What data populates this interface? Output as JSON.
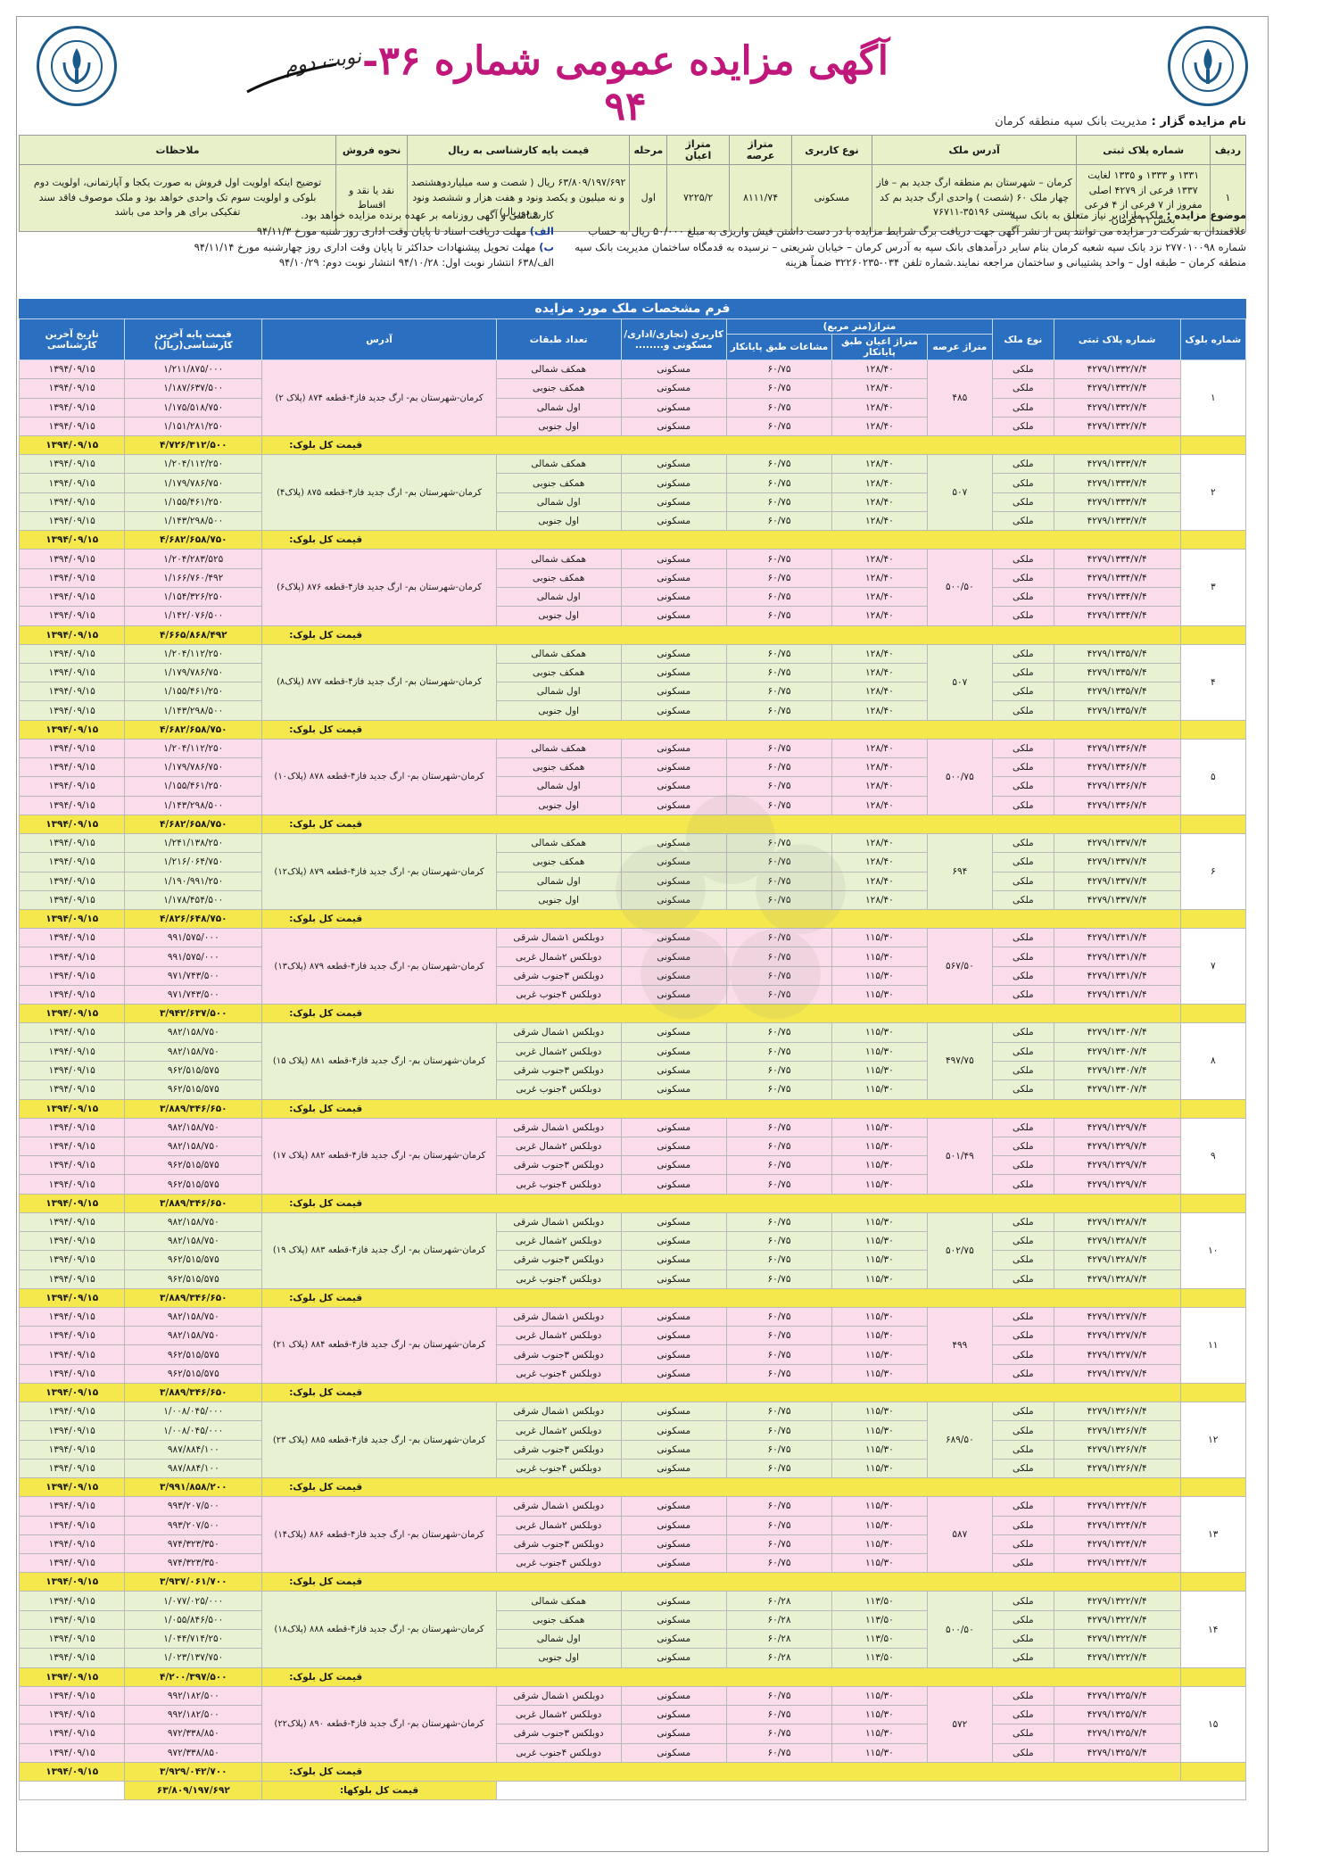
{
  "header": {
    "title": "آگهی مزایده عمومی شماره  ۳۶- ۹۴",
    "nobat": "نوبت دوم",
    "auctioneer_label": "نام مزایده گزار : ",
    "auctioneer_value": "مدیریت بانک سپه منطقه کرمان"
  },
  "summary": {
    "headers": [
      "ردیف",
      "شماره پلاک ثبتی",
      "آدرس ملک",
      "نوع کاربری",
      "متراژ عرصه",
      "متراژ اعیان",
      "مرحله",
      "قیمت پایه کارشناسی به ریال",
      "نحوه فروش",
      "ملاحظات"
    ],
    "row": [
      "۱",
      "۱۳۳۱ و ۱۳۳۳ و ۱۳۳۵ لغایت ۱۳۳۷ فرعی از ۴۲۷۹ اصلی مفروز از ۷ فرعی از ۴ فرعی بخش ۳۱ کرمان",
      "کرمان – شهرستان بم منطقه ارگ جدید بم – فاز چهار ملک ۶۰ (شصت ) واحدی ارگ جدید بم کد پستی ۳۵۱۹۶-۷۶۷۱۱",
      "مسکونی",
      "۸۱۱۱/۷۴",
      "۷۲۲۵/۲",
      "اول",
      "۶۳/۸۰۹/۱۹۷/۶۹۲ ریال ( شصت و سه میلیاردوهشتصد و نه میلیون و یکصد ونود و هفت هزار و ششصد ونود و دوریال)",
      "نقد یا نقد و اقساط",
      "توضیح اینکه اولویت اول فروش به صورت یکجا و آپارتمانی، اولویت دوم بلوکی و اولویت سوم تک واحدی خواهد بود و ملک موصوف فاقد سند تفکیکی برای هر واحد می باشد"
    ]
  },
  "notes": {
    "subject_label": "موضوع مزایده :",
    "subject_text": " ملک مازاد بر نیاز متعلق به بانک سپه",
    "para": "علاقمندان به شرکت در مزایده می توانند پس از نشر آگهی جهت دریافت برگ شرایط مزایده با در دست داشتن فیش واریزی به مبلغ ۵۰/۰۰۰ ریال به حساب شماره ۲۷۷۰۱۰۰۹۸ نزد بانک سپه شعبه کرمان بنام سایر درآمدهای بانک سپه به آدرس کرمان – خیابان شریعتی – نرسیده به قدمگاه ساختمان مدیریت بانک سپه منطقه کرمان – طبقه اول – واحد پشتیبانی و ساختمان مراجعه نمایند.شماره تلفن ۰۳۴-۳۲۲۶۰۲۳۵ ضمناً هزینه",
    "r1": "کارشناسی و آگهی روزنامه بر عهده برنده مزایده خواهد بود.",
    "r2_label": "الف)",
    "r2": " مهلت دریافت اسناد تا پایان وقت اداری روز شنبه مورخ ۹۴/۱۱/۳",
    "r3_label": "ب)",
    "r3": " مهلت تحویل پیشنهادات حداکثر تا پایان وقت اداری روز چهارشنبه مورخ ۹۴/۱۱/۱۴",
    "r4": "الف/۶۳۸    انتشار نوبت اول: ۹۴/۱۰/۲۸         انتشار نوبت دوم: ۹۴/۱۰/۲۹"
  },
  "form_title": "فرم مشخصات ملک مورد مزایده",
  "table_headers": {
    "block_no": "شماره بلوک",
    "plate": "شماره پلاک ثبتی",
    "ownership": "نوع ملک",
    "metraj_group": "متراژ(متر مربع)",
    "arse": "متراژ عرصه",
    "ayan": "متراژ اعیان طبق پایانکار",
    "mosha": "مشاعات طبق پایانکار",
    "usage": "کاربری (تجاری/اداری/ مسکونی و........",
    "floors": "تعداد طبقات",
    "address": "آدرس",
    "price": "قیمت پایه آخرین کارشناسی(ریال)",
    "date": "تاریخ آخرین کارشناسی"
  },
  "total_label": "قیمت کل بلوک:",
  "grand_label": "قیمت کل بلوکها:",
  "grand_value": "۶۳/۸۰۹/۱۹۷/۶۹۲",
  "usage_value": "مسکونی",
  "owner_value": "ملکی",
  "date_value": "۱۳۹۴/۰۹/۱۵",
  "blocks": [
    {
      "no": "۱",
      "arse": "۴۸۵",
      "addr": "کرمان-شهرستان بم- ارگ جدید فاز۴-قطعه ۸۷۴ (پلاک ۲)",
      "total": "۴/۷۲۶/۳۱۲/۵۰۰",
      "rows": [
        {
          "plate": "۴۲۷۹/۱۳۳۲/۷/۴",
          "ayan": "۱۲۸/۴۰",
          "mosha": "۶۰/۷۵",
          "floor": "همکف شمالی",
          "price": "۱/۲۱۱/۸۷۵/۰۰۰"
        },
        {
          "plate": "۴۲۷۹/۱۳۳۲/۷/۴",
          "ayan": "۱۲۸/۴۰",
          "mosha": "۶۰/۷۵",
          "floor": "همکف جنوبی",
          "price": "۱/۱۸۷/۶۳۷/۵۰۰"
        },
        {
          "plate": "۴۲۷۹/۱۳۳۲/۷/۴",
          "ayan": "۱۲۸/۴۰",
          "mosha": "۶۰/۷۵",
          "floor": "اول شمالی",
          "price": "۱/۱۷۵/۵۱۸/۷۵۰"
        },
        {
          "plate": "۴۲۷۹/۱۳۳۲/۷/۴",
          "ayan": "۱۲۸/۴۰",
          "mosha": "۶۰/۷۵",
          "floor": "اول جنوبی",
          "price": "۱/۱۵۱/۲۸۱/۲۵۰"
        }
      ]
    },
    {
      "no": "۲",
      "arse": "۵۰۷",
      "addr": "کرمان-شهرستان بم- ارگ جدید فاز۴-قطعه ۸۷۵ (پلاک۴)",
      "total": "۴/۶۸۲/۶۵۸/۷۵۰",
      "rows": [
        {
          "plate": "۴۲۷۹/۱۳۳۳/۷/۴",
          "ayan": "۱۲۸/۴۰",
          "mosha": "۶۰/۷۵",
          "floor": "همکف شمالی",
          "price": "۱/۲۰۴/۱۱۲/۲۵۰"
        },
        {
          "plate": "۴۲۷۹/۱۳۳۳/۷/۴",
          "ayan": "۱۲۸/۴۰",
          "mosha": "۶۰/۷۵",
          "floor": "همکف جنوبی",
          "price": "۱/۱۷۹/۷۸۶/۷۵۰"
        },
        {
          "plate": "۴۲۷۹/۱۳۳۳/۷/۴",
          "ayan": "۱۲۸/۴۰",
          "mosha": "۶۰/۷۵",
          "floor": "اول شمالی",
          "price": "۱/۱۵۵/۴۶۱/۲۵۰"
        },
        {
          "plate": "۴۲۷۹/۱۳۳۳/۷/۴",
          "ayan": "۱۲۸/۴۰",
          "mosha": "۶۰/۷۵",
          "floor": "اول جنوبی",
          "price": "۱/۱۴۳/۲۹۸/۵۰۰"
        }
      ]
    },
    {
      "no": "۳",
      "arse": "۵۰۰/۵۰",
      "addr": "کرمان-شهرستان بم- ارگ جدید فاز۴-قطعه ۸۷۶ (پلاک۶)",
      "total": "۴/۶۶۵/۸۶۸/۴۹۲",
      "rows": [
        {
          "plate": "۴۲۷۹/۱۳۳۴/۷/۴",
          "ayan": "۱۲۸/۴۰",
          "mosha": "۶۰/۷۵",
          "floor": "همکف شمالی",
          "price": "۱/۲۰۴/۲۸۳/۵۲۵"
        },
        {
          "plate": "۴۲۷۹/۱۳۳۴/۷/۴",
          "ayan": "۱۲۸/۴۰",
          "mosha": "۶۰/۷۵",
          "floor": "همکف جنوبی",
          "price": "۱/۱۶۶/۷۶۰/۴۹۲"
        },
        {
          "plate": "۴۲۷۹/۱۳۳۴/۷/۴",
          "ayan": "۱۲۸/۴۰",
          "mosha": "۶۰/۷۵",
          "floor": "اول شمالی",
          "price": "۱/۱۵۴/۳۲۶/۲۵۰"
        },
        {
          "plate": "۴۲۷۹/۱۳۳۴/۷/۴",
          "ayan": "۱۲۸/۴۰",
          "mosha": "۶۰/۷۵",
          "floor": "اول جنوبی",
          "price": "۱/۱۴۲/۰۷۶/۵۰۰"
        }
      ]
    },
    {
      "no": "۴",
      "arse": "۵۰۷",
      "addr": "کرمان-شهرستان بم- ارگ جدید فاز۴-قطعه ۸۷۷ (پلاک۸)",
      "total": "۴/۶۸۲/۶۵۸/۷۵۰",
      "rows": [
        {
          "plate": "۴۲۷۹/۱۳۳۵/۷/۴",
          "ayan": "۱۲۸/۴۰",
          "mosha": "۶۰/۷۵",
          "floor": "همکف شمالی",
          "price": "۱/۲۰۴/۱۱۲/۲۵۰"
        },
        {
          "plate": "۴۲۷۹/۱۳۳۵/۷/۴",
          "ayan": "۱۲۸/۴۰",
          "mosha": "۶۰/۷۵",
          "floor": "همکف جنوبی",
          "price": "۱/۱۷۹/۷۸۶/۷۵۰"
        },
        {
          "plate": "۴۲۷۹/۱۳۳۵/۷/۴",
          "ayan": "۱۲۸/۴۰",
          "mosha": "۶۰/۷۵",
          "floor": "اول شمالی",
          "price": "۱/۱۵۵/۴۶۱/۲۵۰"
        },
        {
          "plate": "۴۲۷۹/۱۳۳۵/۷/۴",
          "ayan": "۱۲۸/۴۰",
          "mosha": "۶۰/۷۵",
          "floor": "اول جنوبی",
          "price": "۱/۱۴۳/۲۹۸/۵۰۰"
        }
      ]
    },
    {
      "no": "۵",
      "arse": "۵۰۰/۷۵",
      "addr": "کرمان-شهرستان بم- ارگ جدید فاز۴-قطعه ۸۷۸ (پلاک۱۰)",
      "total": "۴/۶۸۲/۶۵۸/۷۵۰",
      "rows": [
        {
          "plate": "۴۲۷۹/۱۳۳۶/۷/۴",
          "ayan": "۱۲۸/۴۰",
          "mosha": "۶۰/۷۵",
          "floor": "همکف شمالی",
          "price": "۱/۲۰۴/۱۱۲/۲۵۰"
        },
        {
          "plate": "۴۲۷۹/۱۳۳۶/۷/۴",
          "ayan": "۱۲۸/۴۰",
          "mosha": "۶۰/۷۵",
          "floor": "همکف جنوبی",
          "price": "۱/۱۷۹/۷۸۶/۷۵۰"
        },
        {
          "plate": "۴۲۷۹/۱۳۳۶/۷/۴",
          "ayan": "۱۲۸/۴۰",
          "mosha": "۶۰/۷۵",
          "floor": "اول شمالی",
          "price": "۱/۱۵۵/۴۶۱/۲۵۰"
        },
        {
          "plate": "۴۲۷۹/۱۳۳۶/۷/۴",
          "ayan": "۱۲۸/۴۰",
          "mosha": "۶۰/۷۵",
          "floor": "اول جنوبی",
          "price": "۱/۱۴۳/۲۹۸/۵۰۰"
        }
      ]
    },
    {
      "no": "۶",
      "arse": "۶۹۴",
      "addr": "کرمان-شهرستان بم- ارگ جدید فاز۴-قطعه ۸۷۹ (پلاک۱۲)",
      "total": "۴/۸۲۶/۶۴۸/۷۵۰",
      "rows": [
        {
          "plate": "۴۲۷۹/۱۳۳۷/۷/۴",
          "ayan": "۱۲۸/۴۰",
          "mosha": "۶۰/۷۵",
          "floor": "همکف شمالی",
          "price": "۱/۲۴۱/۱۳۸/۲۵۰"
        },
        {
          "plate": "۴۲۷۹/۱۳۳۷/۷/۴",
          "ayan": "۱۲۸/۴۰",
          "mosha": "۶۰/۷۵",
          "floor": "همکف جنوبی",
          "price": "۱/۲۱۶/۰۶۴/۷۵۰"
        },
        {
          "plate": "۴۲۷۹/۱۳۳۷/۷/۴",
          "ayan": "۱۲۸/۴۰",
          "mosha": "۶۰/۷۵",
          "floor": "اول شمالی",
          "price": "۱/۱۹۰/۹۹۱/۲۵۰"
        },
        {
          "plate": "۴۲۷۹/۱۳۳۷/۷/۴",
          "ayan": "۱۲۸/۴۰",
          "mosha": "۶۰/۷۵",
          "floor": "اول جنوبی",
          "price": "۱/۱۷۸/۴۵۴/۵۰۰"
        }
      ]
    },
    {
      "no": "۷",
      "arse": "۵۶۷/۵۰",
      "addr": "کرمان-شهرستان بم- ارگ جدید فاز۴-قطعه ۸۷۹ (پلاک۱۳)",
      "total": "۳/۹۴۲/۶۳۷/۵۰۰",
      "rows": [
        {
          "plate": "۴۲۷۹/۱۳۳۱/۷/۴",
          "ayan": "۱۱۵/۳۰",
          "mosha": "۶۰/۷۵",
          "floor": "دوبلکس ۱شمال شرقی",
          "price": "۹۹۱/۵۷۵/۰۰۰"
        },
        {
          "plate": "۴۲۷۹/۱۳۳۱/۷/۴",
          "ayan": "۱۱۵/۳۰",
          "mosha": "۶۰/۷۵",
          "floor": "دوبلکس ۲شمال غربی",
          "price": "۹۹۱/۵۷۵/۰۰۰"
        },
        {
          "plate": "۴۲۷۹/۱۳۳۱/۷/۴",
          "ayan": "۱۱۵/۳۰",
          "mosha": "۶۰/۷۵",
          "floor": "دوبلکس ۳جنوب شرقی",
          "price": "۹۷۱/۷۴۳/۵۰۰"
        },
        {
          "plate": "۴۲۷۹/۱۳۳۱/۷/۴",
          "ayan": "۱۱۵/۳۰",
          "mosha": "۶۰/۷۵",
          "floor": "دوبلکس ۴جنوب غربی",
          "price": "۹۷۱/۷۴۳/۵۰۰"
        }
      ]
    },
    {
      "no": "۸",
      "arse": "۴۹۷/۷۵",
      "addr": "کرمان-شهرستان بم- ارگ جدید فاز۴-قطعه ۸۸۱ (پلاک ۱۵)",
      "total": "۳/۸۸۹/۳۴۶/۶۵۰",
      "rows": [
        {
          "plate": "۴۲۷۹/۱۳۳۰/۷/۴",
          "ayan": "۱۱۵/۳۰",
          "mosha": "۶۰/۷۵",
          "floor": "دوبلکس ۱شمال شرقی",
          "price": "۹۸۲/۱۵۸/۷۵۰"
        },
        {
          "plate": "۴۲۷۹/۱۳۳۰/۷/۴",
          "ayan": "۱۱۵/۳۰",
          "mosha": "۶۰/۷۵",
          "floor": "دوبلکس ۲شمال غربی",
          "price": "۹۸۲/۱۵۸/۷۵۰"
        },
        {
          "plate": "۴۲۷۹/۱۳۳۰/۷/۴",
          "ayan": "۱۱۵/۳۰",
          "mosha": "۶۰/۷۵",
          "floor": "دوبلکس ۳جنوب شرقی",
          "price": "۹۶۲/۵۱۵/۵۷۵"
        },
        {
          "plate": "۴۲۷۹/۱۳۳۰/۷/۴",
          "ayan": "۱۱۵/۳۰",
          "mosha": "۶۰/۷۵",
          "floor": "دوبلکس ۴جنوب غربی",
          "price": "۹۶۲/۵۱۵/۵۷۵"
        }
      ]
    },
    {
      "no": "۹",
      "arse": "۵۰۱/۴۹",
      "addr": "کرمان-شهرستان بم- ارگ جدید فاز۴-قطعه ۸۸۲ (پلاک ۱۷)",
      "total": "۳/۸۸۹/۳۴۶/۶۵۰",
      "rows": [
        {
          "plate": "۴۲۷۹/۱۳۲۹/۷/۴",
          "ayan": "۱۱۵/۳۰",
          "mosha": "۶۰/۷۵",
          "floor": "دوبلکس ۱شمال شرقی",
          "price": "۹۸۲/۱۵۸/۷۵۰"
        },
        {
          "plate": "۴۲۷۹/۱۳۲۹/۷/۴",
          "ayan": "۱۱۵/۳۰",
          "mosha": "۶۰/۷۵",
          "floor": "دوبلکس ۲شمال غربی",
          "price": "۹۸۲/۱۵۸/۷۵۰"
        },
        {
          "plate": "۴۲۷۹/۱۳۲۹/۷/۴",
          "ayan": "۱۱۵/۳۰",
          "mosha": "۶۰/۷۵",
          "floor": "دوبلکس ۳جنوب شرقی",
          "price": "۹۶۲/۵۱۵/۵۷۵"
        },
        {
          "plate": "۴۲۷۹/۱۳۲۹/۷/۴",
          "ayan": "۱۱۵/۳۰",
          "mosha": "۶۰/۷۵",
          "floor": "دوبلکس ۴جنوب غربی",
          "price": "۹۶۲/۵۱۵/۵۷۵"
        }
      ]
    },
    {
      "no": "۱۰",
      "arse": "۵۰۲/۷۵",
      "addr": "کرمان-شهرستان بم- ارگ جدید فاز۴-قطعه ۸۸۳ (پلاک ۱۹)",
      "total": "۳/۸۸۹/۳۴۶/۶۵۰",
      "rows": [
        {
          "plate": "۴۲۷۹/۱۳۲۸/۷/۴",
          "ayan": "۱۱۵/۳۰",
          "mosha": "۶۰/۷۵",
          "floor": "دوبلکس ۱شمال شرقی",
          "price": "۹۸۲/۱۵۸/۷۵۰"
        },
        {
          "plate": "۴۲۷۹/۱۳۲۸/۷/۴",
          "ayan": "۱۱۵/۳۰",
          "mosha": "۶۰/۷۵",
          "floor": "دوبلکس ۲شمال غربی",
          "price": "۹۸۲/۱۵۸/۷۵۰"
        },
        {
          "plate": "۴۲۷۹/۱۳۲۸/۷/۴",
          "ayan": "۱۱۵/۳۰",
          "mosha": "۶۰/۷۵",
          "floor": "دوبلکس ۳جنوب شرقی",
          "price": "۹۶۲/۵۱۵/۵۷۵"
        },
        {
          "plate": "۴۲۷۹/۱۳۲۸/۷/۴",
          "ayan": "۱۱۵/۳۰",
          "mosha": "۶۰/۷۵",
          "floor": "دوبلکس ۴جنوب غربی",
          "price": "۹۶۲/۵۱۵/۵۷۵"
        }
      ]
    },
    {
      "no": "۱۱",
      "arse": "۴۹۹",
      "addr": "کرمان-شهرستان بم- ارگ جدید فاز۴-قطعه ۸۸۴ (پلاک ۲۱)",
      "total": "۳/۸۸۹/۳۴۶/۶۵۰",
      "rows": [
        {
          "plate": "۴۲۷۹/۱۳۲۷/۷/۴",
          "ayan": "۱۱۵/۳۰",
          "mosha": "۶۰/۷۵",
          "floor": "دوبلکس ۱شمال شرقی",
          "price": "۹۸۲/۱۵۸/۷۵۰"
        },
        {
          "plate": "۴۲۷۹/۱۳۲۷/۷/۴",
          "ayan": "۱۱۵/۳۰",
          "mosha": "۶۰/۷۵",
          "floor": "دوبلکس ۲شمال غربی",
          "price": "۹۸۲/۱۵۸/۷۵۰"
        },
        {
          "plate": "۴۲۷۹/۱۳۲۷/۷/۴",
          "ayan": "۱۱۵/۳۰",
          "mosha": "۶۰/۷۵",
          "floor": "دوبلکس ۳جنوب شرقی",
          "price": "۹۶۲/۵۱۵/۵۷۵"
        },
        {
          "plate": "۴۲۷۹/۱۳۲۷/۷/۴",
          "ayan": "۱۱۵/۳۰",
          "mosha": "۶۰/۷۵",
          "floor": "دوبلکس ۴جنوب غربی",
          "price": "۹۶۲/۵۱۵/۵۷۵"
        }
      ]
    },
    {
      "no": "۱۲",
      "arse": "۶۸۹/۵۰",
      "addr": "کرمان-شهرستان بم- ارگ جدید فاز۴-قطعه ۸۸۵ (پلاک ۲۳)",
      "total": "۳/۹۹۱/۸۵۸/۲۰۰",
      "rows": [
        {
          "plate": "۴۲۷۹/۱۳۲۶/۷/۴",
          "ayan": "۱۱۵/۳۰",
          "mosha": "۶۰/۷۵",
          "floor": "دوبلکس ۱شمال شرقی",
          "price": "۱/۰۰۸/۰۴۵/۰۰۰"
        },
        {
          "plate": "۴۲۷۹/۱۳۲۶/۷/۴",
          "ayan": "۱۱۵/۳۰",
          "mosha": "۶۰/۷۵",
          "floor": "دوبلکس ۲شمال غربی",
          "price": "۱/۰۰۸/۰۴۵/۰۰۰"
        },
        {
          "plate": "۴۲۷۹/۱۳۲۶/۷/۴",
          "ayan": "۱۱۵/۳۰",
          "mosha": "۶۰/۷۵",
          "floor": "دوبلکس ۳جنوب شرقی",
          "price": "۹۸۷/۸۸۴/۱۰۰"
        },
        {
          "plate": "۴۲۷۹/۱۳۲۶/۷/۴",
          "ayan": "۱۱۵/۳۰",
          "mosha": "۶۰/۷۵",
          "floor": "دوبلکس ۴جنوب غربی",
          "price": "۹۸۷/۸۸۴/۱۰۰"
        }
      ]
    },
    {
      "no": "۱۳",
      "arse": "۵۸۷",
      "addr": "کرمان-شهرستان بم- ارگ جدید فاز۴-قطعه ۸۸۶ (پلاک۱۴)",
      "total": "۳/۹۳۷/۰۶۱/۷۰۰",
      "rows": [
        {
          "plate": "۴۲۷۹/۱۳۲۴/۷/۴",
          "ayan": "۱۱۵/۳۰",
          "mosha": "۶۰/۷۵",
          "floor": "دوبلکس ۱شمال شرقی",
          "price": "۹۹۳/۲۰۷/۵۰۰"
        },
        {
          "plate": "۴۲۷۹/۱۳۲۴/۷/۴",
          "ayan": "۱۱۵/۳۰",
          "mosha": "۶۰/۷۵",
          "floor": "دوبلکس ۲شمال غربی",
          "price": "۹۹۳/۲۰۷/۵۰۰"
        },
        {
          "plate": "۴۲۷۹/۱۳۲۴/۷/۴",
          "ayan": "۱۱۵/۳۰",
          "mosha": "۶۰/۷۵",
          "floor": "دوبلکس ۳جنوب شرقی",
          "price": "۹۷۴/۳۲۳/۳۵۰"
        },
        {
          "plate": "۴۲۷۹/۱۳۲۴/۷/۴",
          "ayan": "۱۱۵/۳۰",
          "mosha": "۶۰/۷۵",
          "floor": "دوبلکس ۴جنوب غربی",
          "price": "۹۷۴/۳۲۳/۳۵۰"
        }
      ]
    },
    {
      "no": "۱۴",
      "arse": "۵۰۰/۵۰",
      "addr": "کرمان-شهرستان بم- ارگ جدید فاز۴-قطعه ۸۸۸ (پلاک۱۸)",
      "total": "۴/۲۰۰/۳۹۷/۵۰۰",
      "rows": [
        {
          "plate": "۴۲۷۹/۱۳۲۲/۷/۴",
          "ayan": "۱۱۳/۵۰",
          "mosha": "۶۰/۲۸",
          "floor": "همکف شمالی",
          "price": "۱/۰۷۷/۰۲۵/۰۰۰"
        },
        {
          "plate": "۴۲۷۹/۱۳۲۲/۷/۴",
          "ayan": "۱۱۳/۵۰",
          "mosha": "۶۰/۲۸",
          "floor": "همکف جنوبی",
          "price": "۱/۰۵۵/۸۴۶/۵۰۰"
        },
        {
          "plate": "۴۲۷۹/۱۳۲۲/۷/۴",
          "ayan": "۱۱۳/۵۰",
          "mosha": "۶۰/۲۸",
          "floor": "اول شمالی",
          "price": "۱/۰۴۴/۷۱۴/۲۵۰"
        },
        {
          "plate": "۴۲۷۹/۱۳۲۲/۷/۴",
          "ayan": "۱۱۳/۵۰",
          "mosha": "۶۰/۲۸",
          "floor": "اول جنوبی",
          "price": "۱/۰۲۳/۱۳۷/۷۵۰"
        }
      ]
    },
    {
      "no": "۱۵",
      "arse": "۵۷۲",
      "addr": "کرمان-شهرستان بم- ارگ جدید فاز۴-قطعه ۸۹۰ (پلاک۲۲)",
      "total": "۳/۹۲۹/۰۴۲/۷۰۰",
      "rows": [
        {
          "plate": "۴۲۷۹/۱۳۲۵/۷/۴",
          "ayan": "۱۱۵/۳۰",
          "mosha": "۶۰/۷۵",
          "floor": "دوبلکس ۱شمال شرقی",
          "price": "۹۹۲/۱۸۲/۵۰۰"
        },
        {
          "plate": "۴۲۷۹/۱۳۲۵/۷/۴",
          "ayan": "۱۱۵/۳۰",
          "mosha": "۶۰/۷۵",
          "floor": "دوبلکس ۲شمال غربی",
          "price": "۹۹۲/۱۸۲/۵۰۰"
        },
        {
          "plate": "۴۲۷۹/۱۳۲۵/۷/۴",
          "ayan": "۱۱۵/۳۰",
          "mosha": "۶۰/۷۵",
          "floor": "دوبلکس ۳جنوب شرقی",
          "price": "۹۷۲/۳۳۸/۸۵۰"
        },
        {
          "plate": "۴۲۷۹/۱۳۲۵/۷/۴",
          "ayan": "۱۱۵/۳۰",
          "mosha": "۶۰/۷۵",
          "floor": "دوبلکس ۴جنوب غربی",
          "price": "۹۷۲/۳۳۸/۸۵۰"
        }
      ]
    }
  ]
}
